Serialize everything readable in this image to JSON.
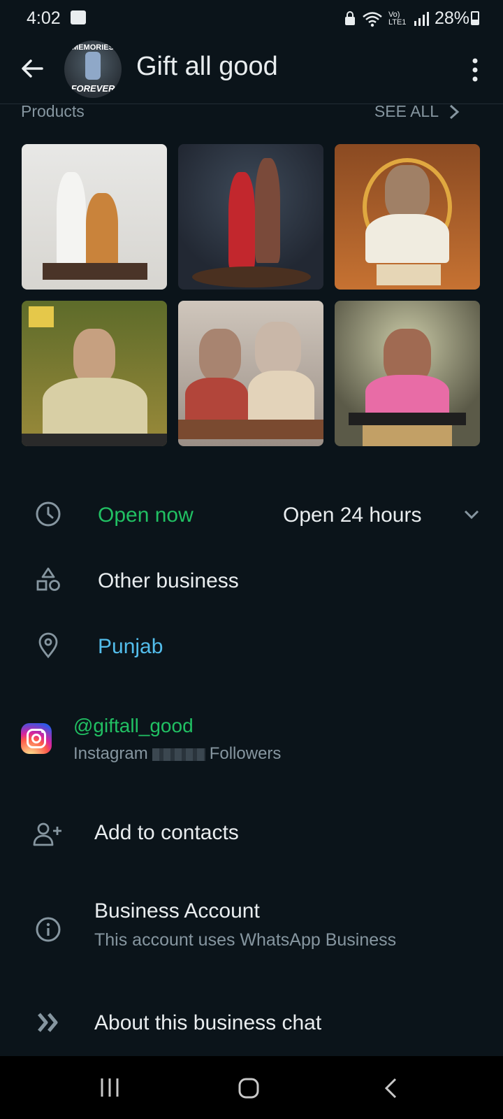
{
  "status_bar": {
    "time": "4:02",
    "network": "Vo) LTE1",
    "battery": "28%"
  },
  "header": {
    "title": "Gift all good",
    "avatar_top_text": "MEMORIES",
    "avatar_bottom_text": "FOREVER"
  },
  "products": {
    "label": "Products",
    "see_all": "SEE ALL"
  },
  "hours": {
    "status": "Open now",
    "detail": "Open 24 hours"
  },
  "category": "Other business",
  "location": "Punjab",
  "instagram": {
    "handle": "@giftall_good",
    "prefix": "Instagram",
    "suffix": "Followers"
  },
  "actions": {
    "add_contact": "Add to contacts",
    "business_account_title": "Business Account",
    "business_account_sub": "This account uses WhatsApp Business",
    "about_chat": "About this business chat"
  },
  "colors": {
    "background": "#0b141a",
    "accent_green": "#21c063",
    "link_blue": "#53bdeb",
    "muted": "#8696a0"
  }
}
